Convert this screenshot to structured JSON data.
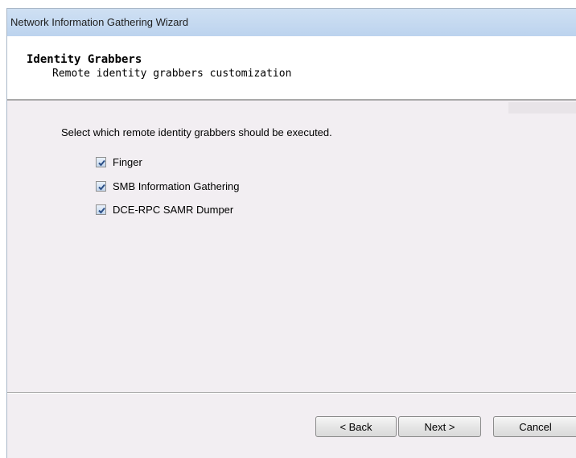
{
  "window": {
    "title": "Network Information Gathering Wizard"
  },
  "header": {
    "title": "Identity Grabbers",
    "subtitle": "Remote identity grabbers customization"
  },
  "content": {
    "instruction": "Select which remote identity grabbers should be executed.",
    "options": [
      {
        "label": "Finger",
        "checked": true
      },
      {
        "label": "SMB Information Gathering",
        "checked": true
      },
      {
        "label": "DCE-RPC SAMR Dumper",
        "checked": true
      }
    ]
  },
  "footer": {
    "back_label": "< Back",
    "next_label": "Next >",
    "cancel_label": "Cancel"
  },
  "colors": {
    "titlebar": "#bcd3ee",
    "panel_background": "#f2eef2",
    "header_background": "#ffffff",
    "checkmark": "#2c4f87"
  }
}
